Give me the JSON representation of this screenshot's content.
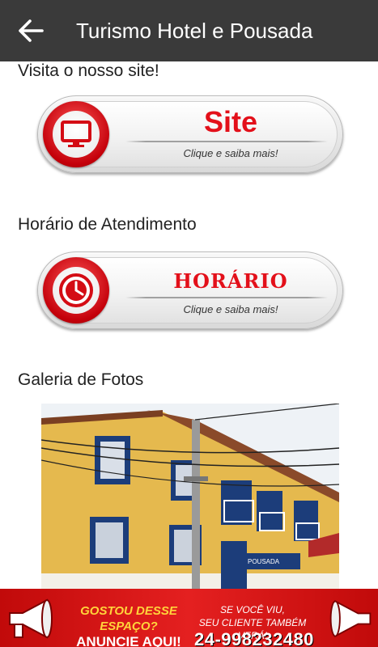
{
  "appbar": {
    "title": "Turismo Hotel e Pousada",
    "back_icon": "arrow-back-icon"
  },
  "sections": {
    "site": {
      "heading": "Visita o nosso site!",
      "button_label": "Site",
      "button_sub": "Clique e saiba mais!",
      "icon": "monitor-icon"
    },
    "hours": {
      "heading": "Horário de Atendimento",
      "button_label": "HORÁRIO",
      "button_sub": "Clique e saiba mais!",
      "icon": "clock-icon"
    },
    "gallery": {
      "heading": "Galeria de Fotos",
      "photo_sign": "POUSADA"
    }
  },
  "banner": {
    "line1": "GOSTOU DESSE ESPAÇO?",
    "line2": "ANUNCIE AQUI!",
    "right1": "SE VOCÊ VIU,",
    "right2": "SEU CLIENTE TAMBÉM VERÁ!",
    "phone": "24-998232480",
    "icon": "megaphone-icon"
  },
  "colors": {
    "appbar": "#3a3a3a",
    "accent_red": "#e3101a",
    "banner_yellow": "#ffd43b"
  }
}
